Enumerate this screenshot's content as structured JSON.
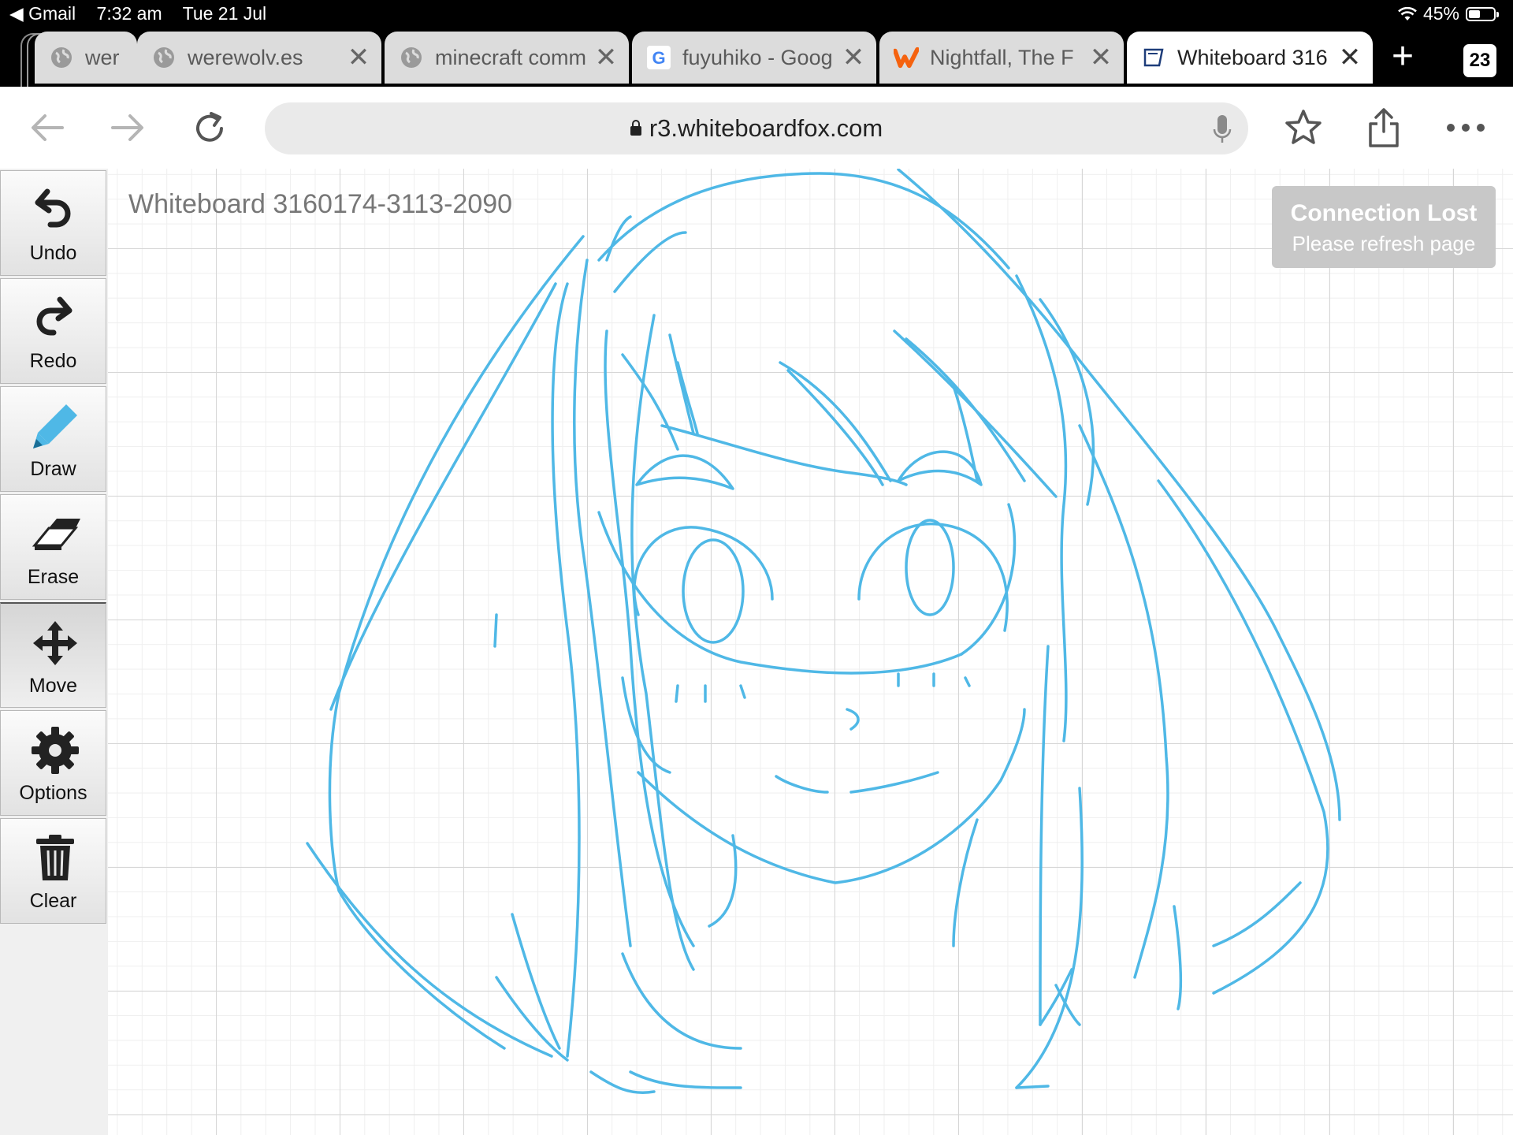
{
  "status_bar": {
    "back_app": "Gmail",
    "time": "7:32 am",
    "date": "Tue 21 Jul",
    "battery_percent": "45%",
    "battery_level": 0.45
  },
  "tabs": [
    {
      "title": "wer",
      "icon": "globe-icon",
      "active": false
    },
    {
      "title": "werewolv.es",
      "icon": "globe-icon",
      "active": false
    },
    {
      "title": "minecraft comm",
      "icon": "globe-icon",
      "active": false
    },
    {
      "title": "fuyuhiko - Goog",
      "icon": "google-icon",
      "active": false
    },
    {
      "title": "Nightfall, The F",
      "icon": "wattpad-icon",
      "active": false
    },
    {
      "title": "Whiteboard 316",
      "icon": "whiteboard-icon",
      "active": true
    }
  ],
  "tab_count": "23",
  "url": "r3.whiteboardfox.com",
  "tools": [
    {
      "label": "Undo",
      "icon": "undo-icon"
    },
    {
      "label": "Redo",
      "icon": "redo-icon"
    },
    {
      "label": "Draw",
      "icon": "pencil-icon"
    },
    {
      "label": "Erase",
      "icon": "eraser-icon"
    },
    {
      "label": "Move",
      "icon": "move-icon",
      "selected": true
    },
    {
      "label": "Options",
      "icon": "gear-icon"
    },
    {
      "label": "Clear",
      "icon": "trash-icon"
    }
  ],
  "whiteboard": {
    "title": "Whiteboard 3160174-3113-2090",
    "stroke_color": "#4fb8e6"
  },
  "connection": {
    "heading": "Connection Lost",
    "message": "Please refresh page"
  }
}
